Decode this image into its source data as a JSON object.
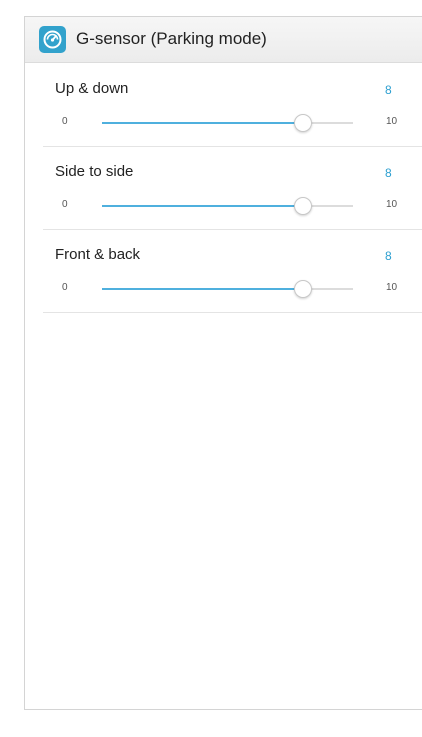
{
  "header": {
    "title": "G-sensor (Parking mode)",
    "icon": "gauge-icon",
    "icon_color": "#32a2cc"
  },
  "settings": [
    {
      "label": "Up & down",
      "value": "8",
      "min": "0",
      "max": "10",
      "level": 0.8
    },
    {
      "label": "Side to side",
      "value": "8",
      "min": "0",
      "max": "10",
      "level": 0.8
    },
    {
      "label": "Front & back",
      "value": "8",
      "min": "0",
      "max": "10",
      "level": 0.8
    }
  ],
  "colors": {
    "accent": "#2c9fd0",
    "slider_fill": "#4fb0de",
    "track": "#dcdcdc"
  }
}
